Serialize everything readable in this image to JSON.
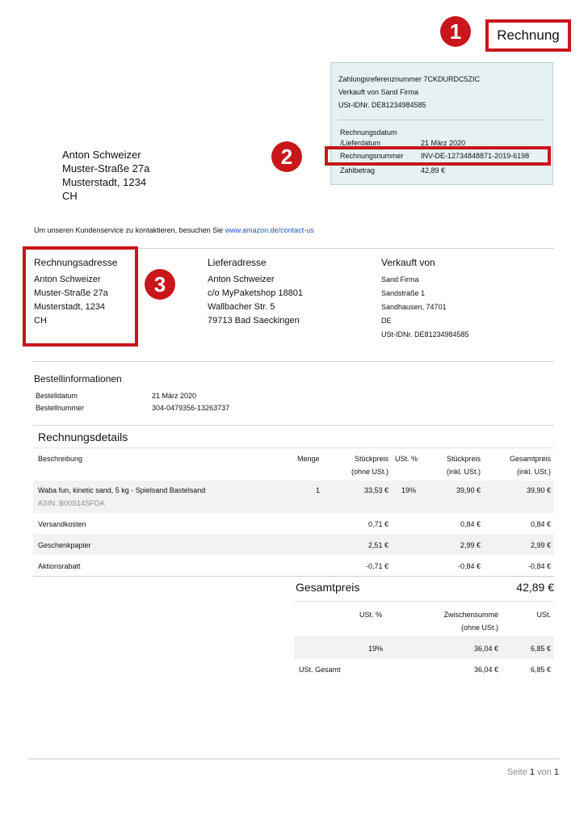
{
  "header": {
    "title": "Rechnung",
    "markers": [
      "1",
      "2",
      "3"
    ]
  },
  "info_panel": {
    "payment_ref": "Zahlungsreferenznummer 7CKDURDC5ZIC",
    "sold_by": "Verkauft von Sand Firma",
    "vat_id": "USt-IDNr. DE81234984585",
    "date_label_1": "Rechnungsdatum",
    "date_label_2": "/Lieferdatum",
    "date_value": "21 März 2020",
    "invoice_no_label": "Rechnungsnummer",
    "invoice_no_value": "INV-DE-12734848871-2019-6198",
    "amount_label": "Zahlbetrag",
    "amount_value": "42,89 €"
  },
  "recipient": {
    "name": "Anton Schweizer",
    "street": "Muster-Straße 27a",
    "city": "Musterstadt, 1234",
    "country": "CH"
  },
  "contact": {
    "text": "Um unseren Kundenservice zu kontaktieren, besuchen Sie ",
    "link": "www.amazon.de/contact-us"
  },
  "billing": {
    "title": "Rechnungsadresse",
    "lines": [
      "Anton Schweizer",
      "Muster-Straße 27a",
      "Musterstadt, 1234",
      "CH"
    ]
  },
  "shipping": {
    "title": "Lieferadresse",
    "lines": [
      "Anton Schweizer",
      "c/o MyPaketshop  18801",
      "Wallbacher Str. 5",
      "79713 Bad Saeckingen"
    ]
  },
  "seller": {
    "title": "Verkauft von",
    "lines": [
      "Sand Firma",
      "Sandstraße 1",
      "Sandhausen, 74701",
      "DE",
      "USt-IDNr.  DE81234984585"
    ]
  },
  "order": {
    "title": "Bestellinformationen",
    "date_label": "Bestelldatum",
    "date_value": "21 März 2020",
    "number_label": "Bestellnummer",
    "number_value": "304-0479356-13263737"
  },
  "details": {
    "title": "Rechnungsdetails",
    "headers": {
      "desc": "Beschreibung",
      "qty": "Menge",
      "unit_net_1": "Stückpreis",
      "unit_net_2": "(ohne USt.)",
      "vat": "USt. %",
      "unit_gross_1": "Stückpreis",
      "unit_gross_2": "(inkl. USt.)",
      "total_1": "Gesamtpreis",
      "total_2": "(inkl. USt.)"
    },
    "item": {
      "desc": "Waba fun, kinetic sand, 5 kg - Spielsand Bastelsand",
      "asin": "ASIN: B00S14SFOA",
      "qty": "1",
      "unit_net": "33,53 €",
      "vat": "19%",
      "unit_gross": "39,90 €",
      "total": "39,90 €"
    },
    "rows": [
      {
        "desc": "Versandkosten",
        "unit_net": "0,71 €",
        "unit_gross": "0,84 €",
        "total": "0,84 €"
      },
      {
        "desc": "Geschenkpapier",
        "unit_net": "2,51 €",
        "unit_gross": "2,99 €",
        "total": "2,99 €"
      },
      {
        "desc": "Aktionsrabatt",
        "unit_net": "-0,71 €",
        "unit_gross": "-0,84 €",
        "total": "-0,84 €"
      }
    ]
  },
  "totals": {
    "label": "Gesamtpreis",
    "value": "42,89 €",
    "vat_header": "USt. %",
    "subtotal_header_1": "Zwischensumme",
    "subtotal_header_2": "(ohne USt.)",
    "vat_amount_header": "USt.",
    "vat_rate": "19%",
    "subtotal": "36,04 €",
    "vat_amount": "6,85 €",
    "vat_total_label": "USt. Gesamt",
    "vat_total_subtotal": "36,04 €",
    "vat_total_amount": "6,85 €"
  },
  "footer": {
    "page_word": "Seite",
    "page_current": "1",
    "of_word": "von",
    "page_total": "1"
  },
  "colors": {
    "accent_red": "#c8161b",
    "panel_bg": "#e6f1f4",
    "link": "#1a55c9"
  }
}
